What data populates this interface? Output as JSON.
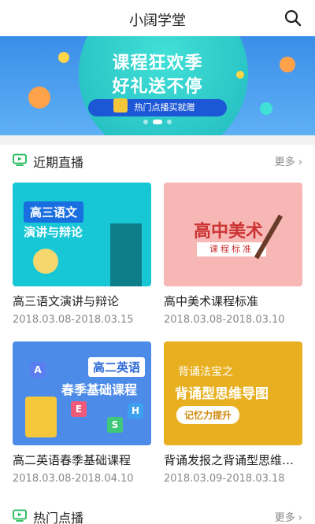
{
  "header": {
    "title": "小阔学堂",
    "search_icon": "search-icon"
  },
  "banner": {
    "line1": "课程狂欢季",
    "line2": "好礼送不停",
    "pill": "热门点播买就赠",
    "page_count": 3,
    "active_page": 1
  },
  "sections": {
    "live": {
      "title": "近期直播",
      "more": "更多 ›",
      "icon": "tv-icon"
    },
    "vod": {
      "title": "热门点播",
      "more": "更多 ›",
      "icon": "tv-icon"
    }
  },
  "courses": [
    {
      "name": "高三语文演讲与辩论",
      "date": "2018.03.08-2018.03.15",
      "thumb": {
        "tag": "高三语文",
        "sub": "演讲与辩论"
      }
    },
    {
      "name": "高中美术课程标准",
      "date": "2018.03.08-2018.03.10",
      "thumb": {
        "big": "高中美术",
        "small": "课程标准"
      }
    },
    {
      "name": "高二英语春季基础课程",
      "date": "2018.03.08-2018.04.10",
      "thumb": {
        "tag": "高二英语",
        "sub": "春季基础课程",
        "letters": [
          "A",
          "E",
          "S",
          "H"
        ]
      }
    },
    {
      "name": "背诵发报之背诵型思维导图",
      "date": "2018.03.09-2018.03.18",
      "thumb": {
        "l1": "背诵法宝之",
        "l2": "背诵型思维导图",
        "pill": "记忆力提升"
      }
    }
  ],
  "colors": {
    "accent_green": "#19b955",
    "banner_blue": "#3b8ee8"
  }
}
